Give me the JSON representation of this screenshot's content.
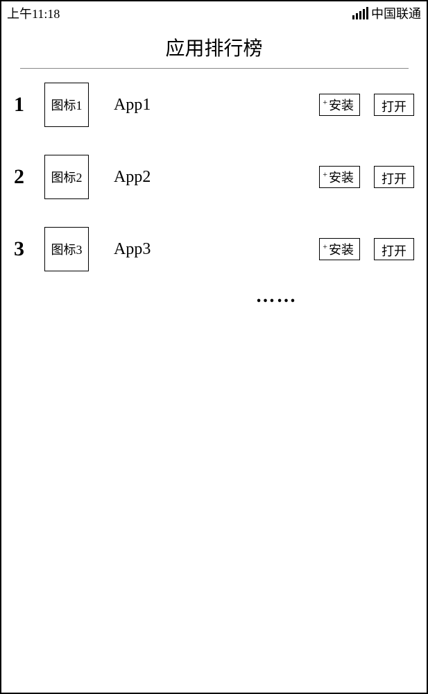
{
  "status": {
    "time": "上午11:18",
    "carrier": "中国联通"
  },
  "page": {
    "title": "应用排行榜",
    "ellipsis": "……"
  },
  "apps": [
    {
      "rank": "1",
      "icon_label": "图标1",
      "name": "App1",
      "install_label": "安装",
      "open_label": "打开"
    },
    {
      "rank": "2",
      "icon_label": "图标2",
      "name": "App2",
      "install_label": "安装",
      "open_label": "打开"
    },
    {
      "rank": "3",
      "icon_label": "图标3",
      "name": "App3",
      "install_label": "安装",
      "open_label": "打开"
    }
  ]
}
